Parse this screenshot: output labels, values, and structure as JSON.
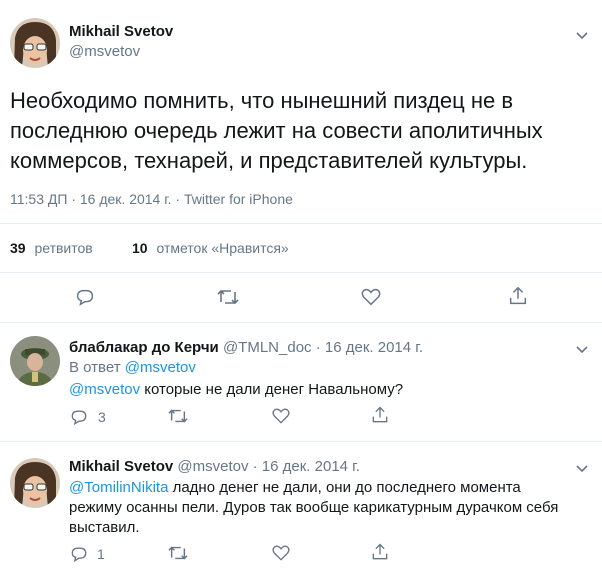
{
  "main_tweet": {
    "author_name": "Mikhail Svetov",
    "author_handle": "@msvetov",
    "text_line1": "Необходимо помнить, что нынешний пиздец не в",
    "text_line2": "последнюю очередь лежит на совести аполитичных",
    "text_line3": "коммерсов, технарей, и представителей культуры.",
    "meta": "11:53 ДП · 16 дек. 2014 г. · Twitter for iPhone",
    "retweets_count": "39",
    "retweets_label": "ретвитов",
    "likes_count": "10",
    "likes_label": "отметок «Нравится»"
  },
  "reply1": {
    "author_name": "блаблакар до Керчи",
    "author_handle": "@TMLN_doc",
    "date": "· 16 дек. 2014 г.",
    "in_reply_prefix": "В ответ",
    "in_reply_handle": "@msvetov",
    "mention": "@msvetov",
    "text": " которые не дали денег Навальному?",
    "reply_count": "3"
  },
  "reply2": {
    "author_name": "Mikhail Svetov",
    "author_handle": "@msvetov",
    "date": "· 16 дек. 2014 г.",
    "mention": "@TomilinNikita",
    "text_line1_rest": " ладно денег не дали, они до последнего момента",
    "text_line2": "режиму осанны пели. Дуров так вообще карикатурным дурачком себя",
    "text_line3": "выставил.",
    "reply_count": "1"
  },
  "colors": {
    "accent": "#1b95e0",
    "muted": "#657786",
    "text": "#14171a",
    "divider": "#e6ecf0"
  },
  "icons": [
    "chevron-down-icon",
    "reply-icon",
    "retweet-icon",
    "like-icon",
    "share-icon"
  ]
}
